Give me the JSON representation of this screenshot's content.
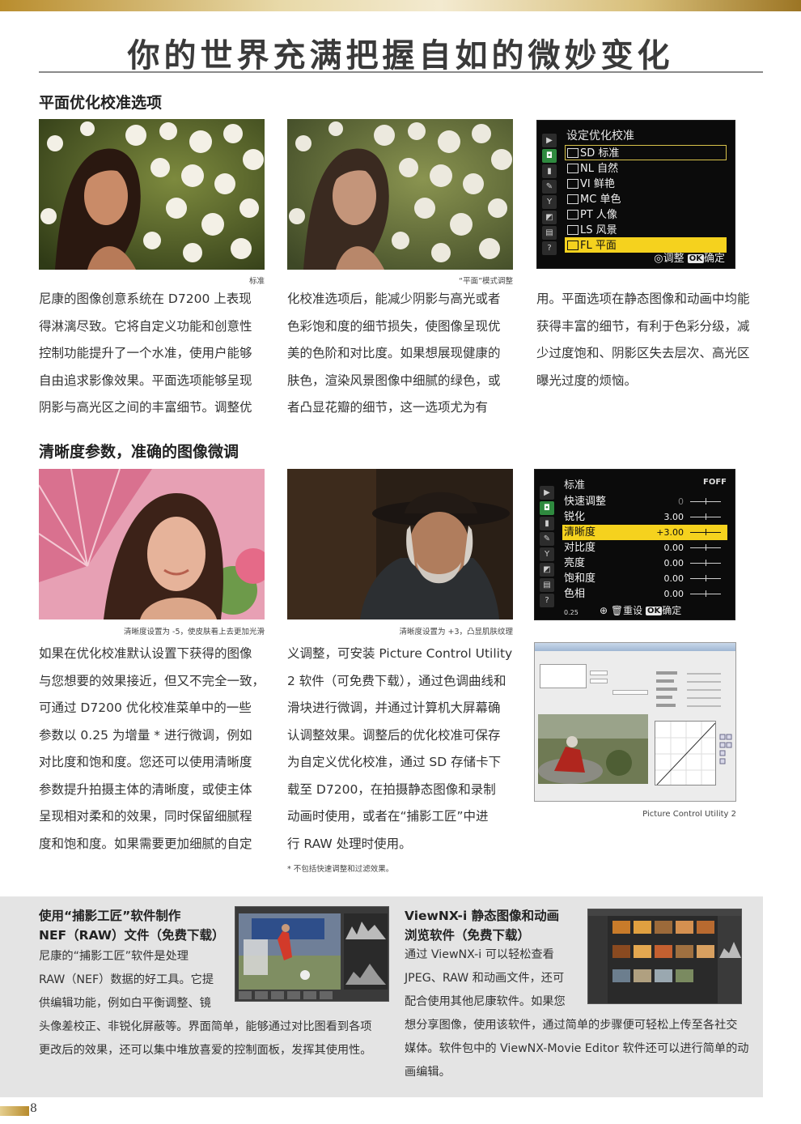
{
  "header": {
    "title": "你的世界充满把握自如的微妙变化"
  },
  "section1": {
    "title": "平面优化校准选项",
    "caption_left": "标准",
    "caption_middle": "“平面”模式调整",
    "col1": [
      "尼康的图像创意系统在 D7200 上表现",
      "得淋漓尽致。它将自定义功能和创意性",
      "控制功能提升了一个水准，使用户能够",
      "自由追求影像效果。平面选项能够呈现",
      "阴影与高光区之间的丰富细节。调整优"
    ],
    "col2": [
      "化校准选项后，能减少阴影与高光或者",
      "色彩饱和度的细节损失，使图像呈现优",
      "美的色阶和对比度。如果想展现健康的",
      "肤色，渲染风景图像中细腻的绿色，或",
      "者凸显花瓣的细节，这一选项尤为有"
    ],
    "col3": [
      "用。平面选项在静态图像和动画中均能",
      "获得丰富的细节，有利于色彩分级，减",
      "少过度饱和、阴影区失去层次、高光区",
      "曝光过度的烦恼。"
    ],
    "menu": {
      "title": "设定优化校准",
      "items": [
        {
          "code": "SD",
          "label": "标准"
        },
        {
          "code": "NL",
          "label": "自然"
        },
        {
          "code": "VI",
          "label": "鲜艳"
        },
        {
          "code": "MC",
          "label": "单色"
        },
        {
          "code": "PT",
          "label": "人像"
        },
        {
          "code": "LS",
          "label": "风景"
        },
        {
          "code": "FL",
          "label": "平面"
        }
      ],
      "selected_index": 6,
      "footer_adjust": "调整",
      "footer_ok_key": "OK",
      "footer_ok": "确定"
    }
  },
  "section2": {
    "title": "清晰度参数，准确的图像微调",
    "caption_left": "清晰度设置为 -5，使皮肤看上去更加光滑",
    "caption_middle": "清晰度设置为 +3，凸显肌肤纹理",
    "caption_right": "Picture Control Utility 2",
    "footnote": "* 不包括快速调整和过滤效果。",
    "col1": [
      "如果在优化校准默认设置下获得的图像",
      "与您想要的效果接近，但又不完全一致，",
      "可通过 D7200 优化校准菜单中的一些",
      "参数以 0.25 为增量 * 进行微调，例如",
      "对比度和饱和度。您还可以使用清晰度",
      "参数提升拍摄主体的清晰度，或使主体",
      "呈现相对柔和的效果，同时保留细腻程",
      "度和饱和度。如果需要更加细腻的自定"
    ],
    "col2": [
      "义调整，可安装 Picture Control Utility",
      "2 软件（可免费下载），通过色调曲线和",
      "滑块进行微调，并通过计算机大屏幕确",
      "认调整效果。调整后的优化校准可保存",
      "为自定义优化校准，通过 SD 存储卡下",
      "载至 D7200，在拍摄静态图像和录制",
      "动画时使用，或者在“捕影工匠”中进",
      "行 RAW 处理时使用。"
    ],
    "menu": {
      "title": "标准",
      "badge": "FOFF",
      "rows": [
        {
          "name": "快速调整",
          "value": "0"
        },
        {
          "name": "锐化",
          "value": "3.00"
        },
        {
          "name": "清晰度",
          "value": "+3.00"
        },
        {
          "name": "对比度",
          "value": "0.00"
        },
        {
          "name": "亮度",
          "value": "0.00"
        },
        {
          "name": "饱和度",
          "value": "0.00"
        },
        {
          "name": "色相",
          "value": "0.00"
        }
      ],
      "selected_index": 2,
      "footer_reset": "重设",
      "footer_ok_key": "OK",
      "footer_ok": "确定",
      "footer_step": "0.25"
    }
  },
  "bottom": {
    "left_title": [
      "使用“捕影工匠”软件制作",
      "NEF（RAW）文件（免费下载）"
    ],
    "left_text_short": [
      "尼康的“捕影工匠”软件是处理",
      "RAW（NEF）数据的好工具。它提",
      "供编辑功能，例如白平衡调整、镜"
    ],
    "left_text_long": [
      "头像差校正、非锐化屏蔽等。界面简单，能够通过对比图看到各项",
      "更改后的效果，还可以集中堆放喜爱的控制面板，发挥其使用性。"
    ],
    "right_title": [
      "ViewNX-i 静态图像和动画",
      "浏览软件（免费下载）"
    ],
    "right_text_short": [
      "通过 ViewNX-i 可以轻松查看",
      "JPEG、RAW 和动画文件，还可",
      "配合使用其他尼康软件。如果您"
    ],
    "right_text_long": [
      "想分享图像，使用该软件，通过简单的步骤便可轻松上传至各社交",
      "媒体。软件包中的 ViewNX-Movie Editor 软件还可以进行简单的动",
      "画编辑。"
    ]
  },
  "page_number": "8"
}
